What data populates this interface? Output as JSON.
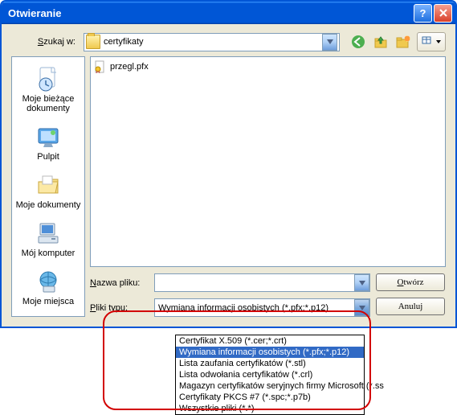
{
  "titlebar": {
    "title": "Otwieranie"
  },
  "lookin": {
    "label": "Szukaj w:",
    "value": "certyfikaty"
  },
  "places": {
    "recent": "Moje bieżące dokumenty",
    "desktop": "Pulpit",
    "mydocs": "Moje dokumenty",
    "mycomp": "Mój komputer",
    "network": "Moje miejsca"
  },
  "files": [
    {
      "name": "przegl.pfx"
    }
  ],
  "filename": {
    "label": "Nazwa pliku:",
    "value": ""
  },
  "filetype": {
    "label": "Pliki typu:",
    "value": "Wymiana informacji osobistych (*.pfx;*.p12)",
    "options": [
      "Certyfikat X.509 (*.cer;*.crt)",
      "Wymiana informacji osobistych (*.pfx;*.p12)",
      "Lista zaufania certyfikatów (*.stl)",
      "Lista odwołania certyfikatów (*.crl)",
      "Magazyn certyfikatów seryjnych firmy Microsoft (*.ss",
      "Certyfikaty PKCS #7 (*.spc;*.p7b)",
      "Wszystkie pliki (*.*)"
    ],
    "selected_index": 1
  },
  "buttons": {
    "open": "Otwórz",
    "cancel": "Anuluj"
  }
}
